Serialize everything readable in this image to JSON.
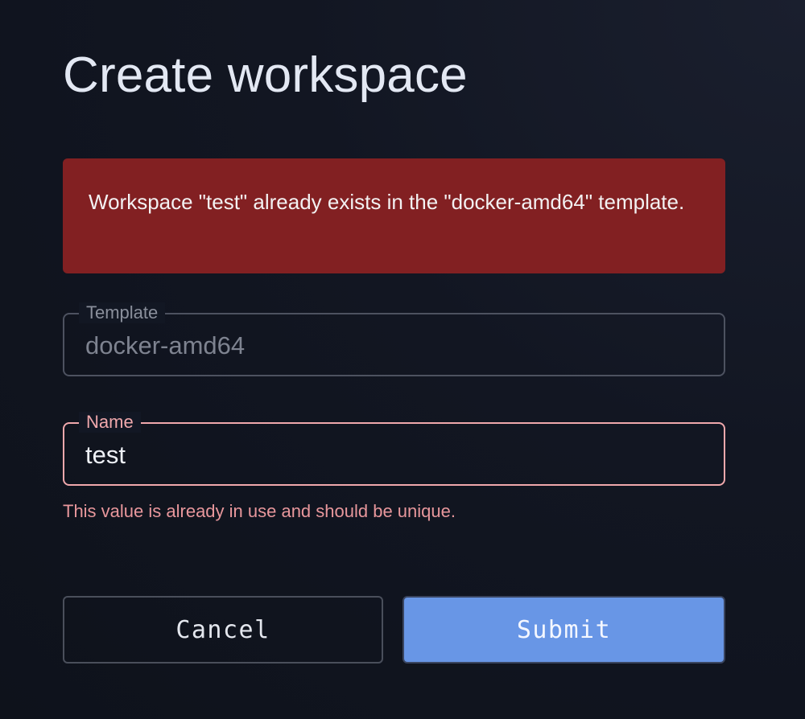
{
  "page": {
    "title": "Create workspace"
  },
  "alert": {
    "message": "Workspace \"test\" already exists in the \"docker-amd64\" template."
  },
  "form": {
    "template": {
      "label": "Template",
      "value": "docker-amd64",
      "disabled": true
    },
    "name": {
      "label": "Name",
      "value": "test",
      "error": "This value is already in use and should be unique."
    }
  },
  "actions": {
    "cancel_label": "Cancel",
    "submit_label": "Submit"
  },
  "colors": {
    "alert_background": "#822022",
    "error": "#f0a8ac",
    "submit_background": "#6896e6"
  }
}
